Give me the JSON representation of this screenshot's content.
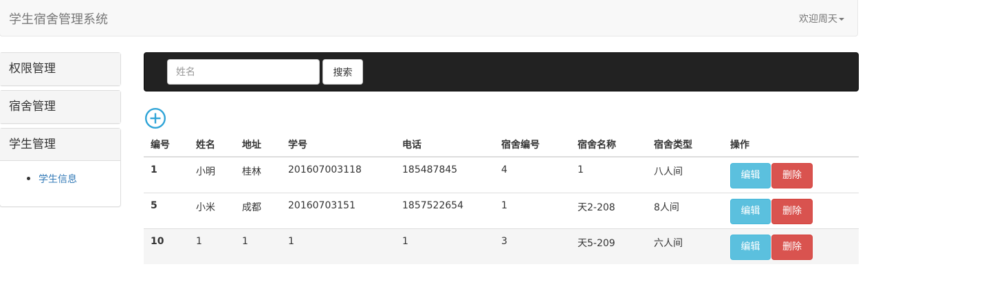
{
  "navbar": {
    "brand": "学生宿舍管理系统",
    "user_menu": "欢迎周天"
  },
  "sidebar": {
    "panels": [
      {
        "label": "权限管理"
      },
      {
        "label": "宿舍管理"
      },
      {
        "label": "学生管理",
        "items": [
          {
            "label": "学生信息"
          }
        ]
      }
    ]
  },
  "search": {
    "placeholder": "姓名",
    "value": "",
    "button_label": "搜索"
  },
  "add_icon": "plus-circle-icon",
  "table": {
    "headers": [
      "编号",
      "姓名",
      "地址",
      "学号",
      "电话",
      "宿舍编号",
      "宿舍名称",
      "宿舍类型",
      "操作"
    ],
    "rows": [
      [
        "1",
        "小明",
        "桂林",
        "201607003118",
        "185487845",
        "4",
        "1",
        "八人间"
      ],
      [
        "5",
        "小米",
        "成都",
        "20160703151",
        "1857522654",
        "1",
        "天2-208",
        "8人间"
      ],
      [
        "10",
        "1",
        "1",
        "1",
        "1",
        "3",
        "天5-209",
        "六人间"
      ]
    ],
    "edit_label": "编辑",
    "delete_label": "删除"
  },
  "colors": {
    "navbar_bg": "#f8f8f8",
    "search_bar_bg": "#222222",
    "edit_button": "#5bc0de",
    "delete_button": "#d9534f",
    "link": "#337ab7",
    "add_icon": "#2fa4d7"
  }
}
